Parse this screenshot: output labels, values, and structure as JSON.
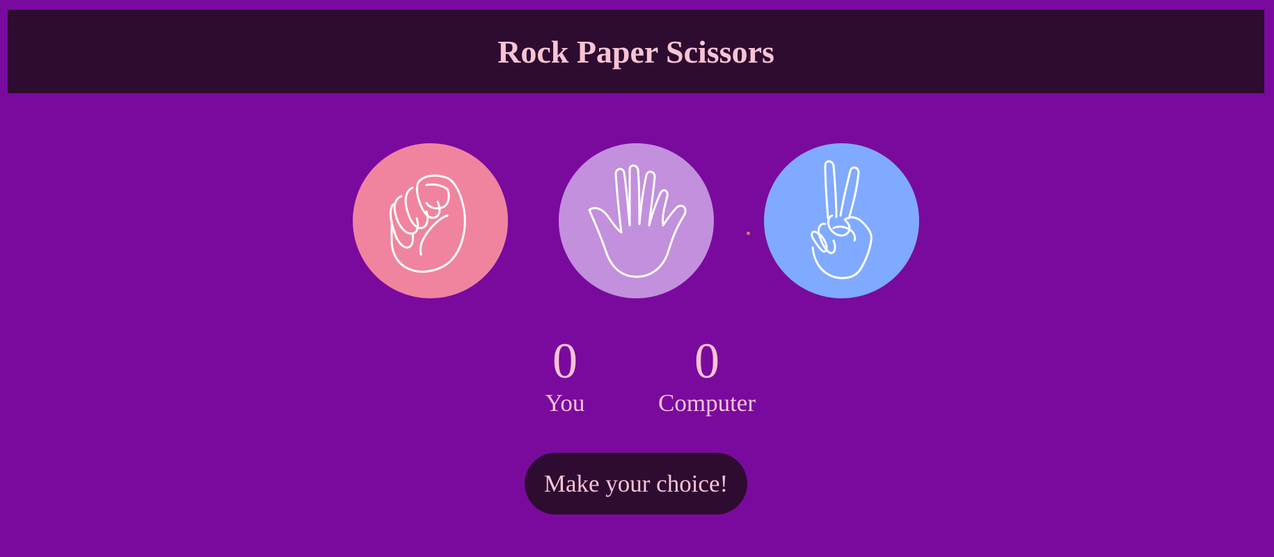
{
  "header": {
    "title": "Rock Paper Scissors"
  },
  "choices": [
    {
      "name": "rock",
      "icon": "fist-icon",
      "color": "#f0849f"
    },
    {
      "name": "paper",
      "icon": "open-hand-icon",
      "color": "#c290dc"
    },
    {
      "name": "scissors",
      "icon": "peace-hand-icon",
      "color": "#80aaff"
    }
  ],
  "scoreboard": {
    "you": {
      "score": "0",
      "label": "You"
    },
    "computer": {
      "score": "0",
      "label": "Computer"
    }
  },
  "status": {
    "message": "Make your choice!"
  },
  "colors": {
    "background": "#7a0a9e",
    "panel": "#2e0b30",
    "text": "#f8c4d4"
  }
}
